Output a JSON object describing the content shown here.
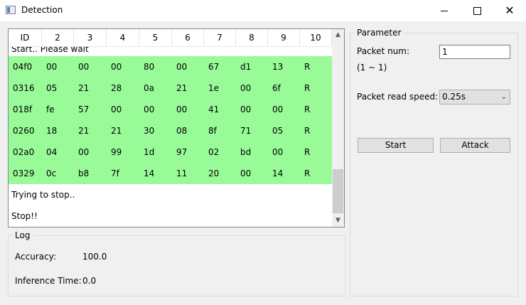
{
  "window": {
    "title": "Detection"
  },
  "table": {
    "columns": [
      "ID",
      "2",
      "3",
      "4",
      "5",
      "6",
      "7",
      "8",
      "9",
      "10"
    ],
    "partial_text": "Start.. Please wait",
    "rows": [
      [
        "04f0",
        "00",
        "00",
        "00",
        "80",
        "00",
        "67",
        "d1",
        "13",
        "R"
      ],
      [
        "0316",
        "05",
        "21",
        "28",
        "0a",
        "21",
        "1e",
        "00",
        "6f",
        "R"
      ],
      [
        "018f",
        "fe",
        "57",
        "00",
        "00",
        "00",
        "41",
        "00",
        "00",
        "R"
      ],
      [
        "0260",
        "18",
        "21",
        "21",
        "30",
        "08",
        "8f",
        "71",
        "05",
        "R"
      ],
      [
        "02a0",
        "04",
        "00",
        "99",
        "1d",
        "97",
        "02",
        "bd",
        "00",
        "R"
      ],
      [
        "0329",
        "0c",
        "b8",
        "7f",
        "14",
        "11",
        "20",
        "00",
        "14",
        "R"
      ]
    ],
    "messages": [
      "Trying to stop..",
      "Stop!!"
    ]
  },
  "log": {
    "title": "Log",
    "accuracy_label": "Accuracy:",
    "accuracy_value": "100.0",
    "inference_label": "Inference Time:",
    "inference_value": "0.0"
  },
  "parameter": {
    "title": "Parameter",
    "packet_num_label": "Packet num:",
    "packet_num_value": "1",
    "range_text": "(1 ~ 1)",
    "speed_label": "Packet read speed:",
    "speed_value": "0.25s",
    "start_label": "Start",
    "attack_label": "Attack"
  },
  "colors": {
    "row_highlight": "#98fb98"
  }
}
